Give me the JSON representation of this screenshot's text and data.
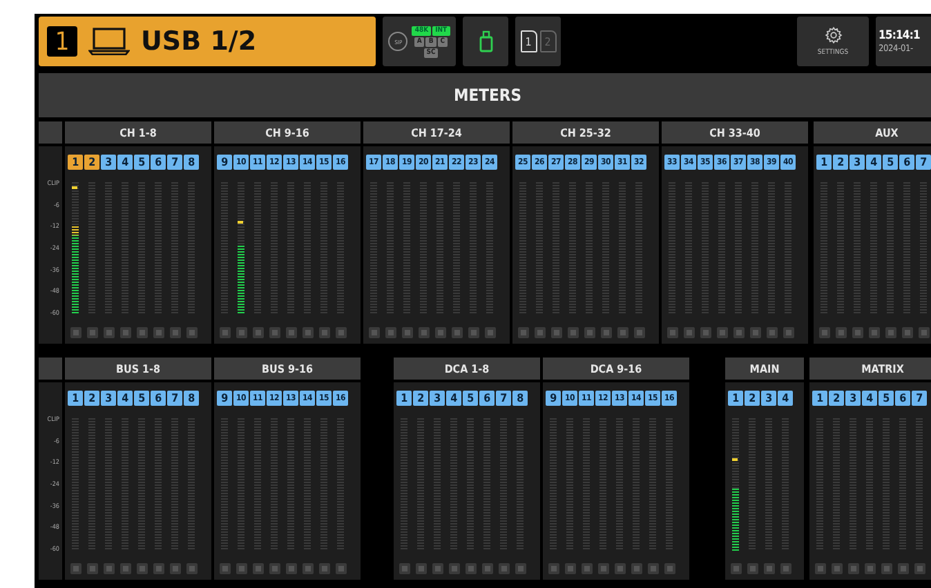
{
  "source": {
    "number": "1",
    "label": "USB 1/2"
  },
  "sync": {
    "label": "SIP"
  },
  "status_rows": [
    [
      {
        "text": "48K",
        "on": true
      },
      {
        "text": "INT",
        "on": true
      }
    ],
    [
      {
        "text": "A",
        "on": false
      },
      {
        "text": "B",
        "on": false
      },
      {
        "text": "C",
        "on": false
      }
    ],
    [
      {
        "text": "SC",
        "on": false
      }
    ]
  ],
  "usb": {
    "on": true
  },
  "cards": [
    {
      "text": "1",
      "selected": true
    },
    {
      "text": "2",
      "selected": false
    }
  ],
  "settings": {
    "label": "SETTINGS"
  },
  "clock": {
    "time": "15:14:1",
    "date": "2024-01-"
  },
  "title": "METERS",
  "rows": [
    {
      "scale": [
        "CLIP",
        "-6",
        "-12",
        "-24",
        "-36",
        "-48",
        "-60"
      ],
      "groups": [
        {
          "title": "CH 1-8",
          "channels": [
            {
              "label": "1",
              "selected": true,
              "level": 0.67,
              "peak": {
                "level": 0.95
              }
            },
            {
              "label": "2",
              "selected": true
            },
            {
              "label": "3",
              "selected": false
            },
            {
              "label": "4",
              "selected": false
            },
            {
              "label": "5",
              "selected": false
            },
            {
              "label": "6",
              "selected": false
            },
            {
              "label": "7",
              "selected": false
            },
            {
              "label": "8",
              "selected": false
            }
          ]
        },
        {
          "title": "CH 9-16",
          "channels": [
            {
              "label": "9",
              "selected": false
            },
            {
              "label": "10",
              "selected": false,
              "level": 0.52,
              "peak": {
                "level": 0.69
              }
            },
            {
              "label": "11",
              "selected": false
            },
            {
              "label": "12",
              "selected": false
            },
            {
              "label": "13",
              "selected": false
            },
            {
              "label": "14",
              "selected": false
            },
            {
              "label": "15",
              "selected": false
            },
            {
              "label": "16",
              "selected": false
            }
          ]
        },
        {
          "title": "CH 17-24",
          "channels": [
            {
              "label": "17",
              "selected": false
            },
            {
              "label": "18",
              "selected": false
            },
            {
              "label": "19",
              "selected": false
            },
            {
              "label": "20",
              "selected": false
            },
            {
              "label": "21",
              "selected": false
            },
            {
              "label": "22",
              "selected": false
            },
            {
              "label": "23",
              "selected": false
            },
            {
              "label": "24",
              "selected": false
            }
          ]
        },
        {
          "title": "CH 25-32",
          "channels": [
            {
              "label": "25",
              "selected": false
            },
            {
              "label": "26",
              "selected": false
            },
            {
              "label": "27",
              "selected": false
            },
            {
              "label": "28",
              "selected": false
            },
            {
              "label": "29",
              "selected": false
            },
            {
              "label": "30",
              "selected": false
            },
            {
              "label": "31",
              "selected": false
            },
            {
              "label": "32",
              "selected": false
            }
          ]
        },
        {
          "title": "CH 33-40",
          "channels": [
            {
              "label": "33",
              "selected": false
            },
            {
              "label": "34",
              "selected": false
            },
            {
              "label": "35",
              "selected": false
            },
            {
              "label": "36",
              "selected": false
            },
            {
              "label": "37",
              "selected": false
            },
            {
              "label": "38",
              "selected": false
            },
            {
              "label": "39",
              "selected": false
            },
            {
              "label": "40",
              "selected": false
            }
          ]
        },
        {
          "title": "AUX",
          "channels": [
            {
              "label": "1",
              "selected": false
            },
            {
              "label": "2",
              "selected": false
            },
            {
              "label": "3",
              "selected": false
            },
            {
              "label": "4",
              "selected": false
            },
            {
              "label": "5",
              "selected": false
            },
            {
              "label": "6",
              "selected": false
            },
            {
              "label": "7",
              "selected": false
            }
          ]
        }
      ]
    },
    {
      "scale": [
        "CLIP",
        "-6",
        "-12",
        "-24",
        "-36",
        "-48",
        "-60"
      ],
      "groups": [
        {
          "title": "BUS 1-8",
          "channels": [
            {
              "label": "1",
              "selected": false
            },
            {
              "label": "2",
              "selected": false
            },
            {
              "label": "3",
              "selected": false
            },
            {
              "label": "4",
              "selected": false
            },
            {
              "label": "5",
              "selected": false
            },
            {
              "label": "6",
              "selected": false
            },
            {
              "label": "7",
              "selected": false
            },
            {
              "label": "8",
              "selected": false
            }
          ]
        },
        {
          "title": "BUS 9-16",
          "channels": [
            {
              "label": "9",
              "selected": false
            },
            {
              "label": "10",
              "selected": false
            },
            {
              "label": "11",
              "selected": false
            },
            {
              "label": "12",
              "selected": false
            },
            {
              "label": "13",
              "selected": false
            },
            {
              "label": "14",
              "selected": false
            },
            {
              "label": "15",
              "selected": false
            },
            {
              "label": "16",
              "selected": false
            }
          ]
        },
        {
          "title": "DCA 1-8",
          "channels": [
            {
              "label": "1",
              "selected": false
            },
            {
              "label": "2",
              "selected": false
            },
            {
              "label": "3",
              "selected": false
            },
            {
              "label": "4",
              "selected": false
            },
            {
              "label": "5",
              "selected": false
            },
            {
              "label": "6",
              "selected": false
            },
            {
              "label": "7",
              "selected": false
            },
            {
              "label": "8",
              "selected": false
            }
          ]
        },
        {
          "title": "DCA 9-16",
          "channels": [
            {
              "label": "9",
              "selected": false
            },
            {
              "label": "10",
              "selected": false
            },
            {
              "label": "11",
              "selected": false
            },
            {
              "label": "12",
              "selected": false
            },
            {
              "label": "13",
              "selected": false
            },
            {
              "label": "14",
              "selected": false
            },
            {
              "label": "15",
              "selected": false
            },
            {
              "label": "16",
              "selected": false
            }
          ]
        },
        {
          "title": "MAIN",
          "channels": [
            {
              "label": "1",
              "selected": false,
              "level": 0.47,
              "peak": {
                "level": 0.68
              }
            },
            {
              "label": "2",
              "selected": false
            },
            {
              "label": "3",
              "selected": false
            },
            {
              "label": "4",
              "selected": false
            }
          ]
        },
        {
          "title": "MATRIX",
          "channels": [
            {
              "label": "1",
              "selected": false
            },
            {
              "label": "2",
              "selected": false
            },
            {
              "label": "3",
              "selected": false
            },
            {
              "label": "4",
              "selected": false
            },
            {
              "label": "5",
              "selected": false
            },
            {
              "label": "6",
              "selected": false
            },
            {
              "label": "7",
              "selected": false
            }
          ]
        }
      ]
    }
  ]
}
